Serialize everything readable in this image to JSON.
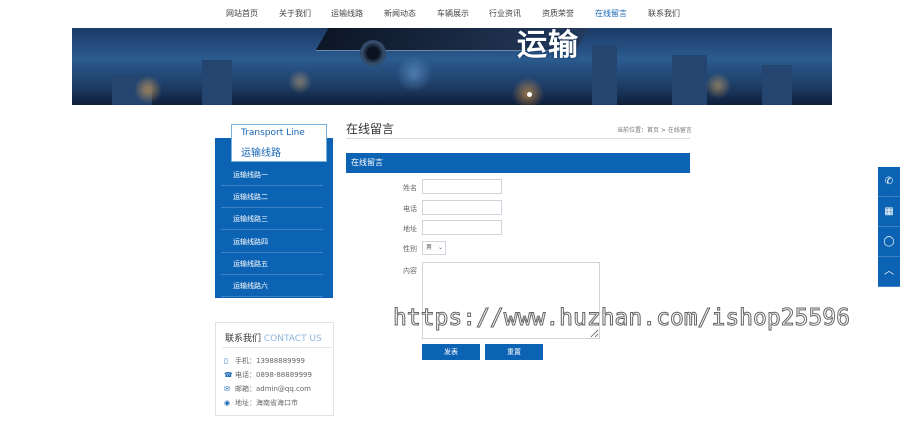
{
  "nav": {
    "items": [
      "网站首页",
      "关于我们",
      "运输线路",
      "新闻动态",
      "车辆展示",
      "行业资讯",
      "资质荣誉",
      "在线留言",
      "联系我们"
    ],
    "active_index": 7
  },
  "banner": {
    "text": "运输"
  },
  "sidebar": {
    "title_en": "Transport Line",
    "title_cn": "运输线路",
    "items": [
      "运输线路一",
      "运输线路二",
      "运输线路三",
      "运输线路四",
      "运输线路五",
      "运输线路六"
    ]
  },
  "contact": {
    "title_cn": "联系我们",
    "title_en": "CONTACT US",
    "rows": [
      {
        "icon": "mobile-icon",
        "label": "手机：",
        "value": "13988889999"
      },
      {
        "icon": "phone-icon",
        "label": "电话：",
        "value": "0898-88889999"
      },
      {
        "icon": "mail-icon",
        "label": "邮箱：",
        "value": "admin@qq.com"
      },
      {
        "icon": "location-icon",
        "label": "地址：",
        "value": "海南省海口市"
      }
    ]
  },
  "main": {
    "title": "在线留言",
    "breadcrumb": "当前位置：首页 > 在线留言",
    "section_bar": "在线留言"
  },
  "form": {
    "name_label": "姓名",
    "phone_label": "电话",
    "address_label": "地址",
    "gender_label": "性别",
    "gender_value": "男",
    "content_label": "内容",
    "submit_label": "发表",
    "reset_label": "重置"
  },
  "watermark": "https://www.huzhan.com/ishop25596",
  "colors": {
    "brand": "#0c63b3",
    "nav_active": "#1565b5"
  }
}
